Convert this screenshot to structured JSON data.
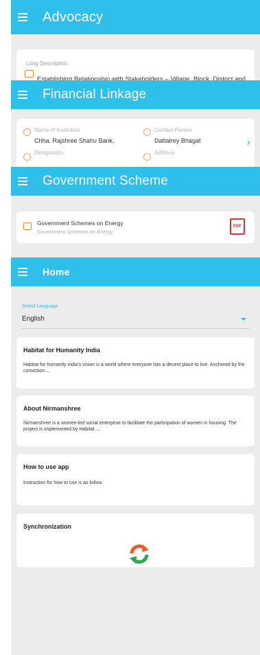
{
  "advocacy": {
    "title": "Advocacy",
    "label": "Long Description",
    "value": "Establishing Relationship with Stakeholders – Village, Block, District and"
  },
  "financial": {
    "title": "Financial Linkage",
    "institution_label": "Name of Institution",
    "institution_value": "Chha. Rajshree Shahu Bank,",
    "contact_label": "Contact Person",
    "contact_value": "Dattatrey Bhagat",
    "designation_label": "Designation",
    "address_label": "Address"
  },
  "government": {
    "title": "Government Scheme",
    "item_title": "Government Schemes on Energy",
    "item_subtitle": "Government Schemes on Energy"
  },
  "home": {
    "title": "Home",
    "language_label": "Select Language",
    "language_value": "English",
    "cards": [
      {
        "title": "Habitat for Humanity India",
        "body": "Habitat for humanity india's vision is a world where everyone has a decent place to live. Anchored by the conviction...."
      },
      {
        "title": "About Nirmanshree",
        "body": "Nirmanshree is a women-led social enterprise to facilitate the participation of women in housing. The project is implemented by Habitat...."
      },
      {
        "title": "How to use app",
        "body": "Instruction for how to use is as follow"
      },
      {
        "title": "Synchronization"
      }
    ]
  },
  "colors": {
    "app_bar": "#2ec0ea",
    "accent_orange": "#e58a3c",
    "pdf_red": "#d9303b",
    "sync_orange": "#ef5a2a",
    "sync_green": "#2fa84f"
  },
  "icons": [
    "menu-icon",
    "document-icon",
    "bank-icon",
    "phone-icon",
    "chevron-right-icon",
    "pdf-icon",
    "dropdown-caret-icon",
    "sync-icon"
  ]
}
